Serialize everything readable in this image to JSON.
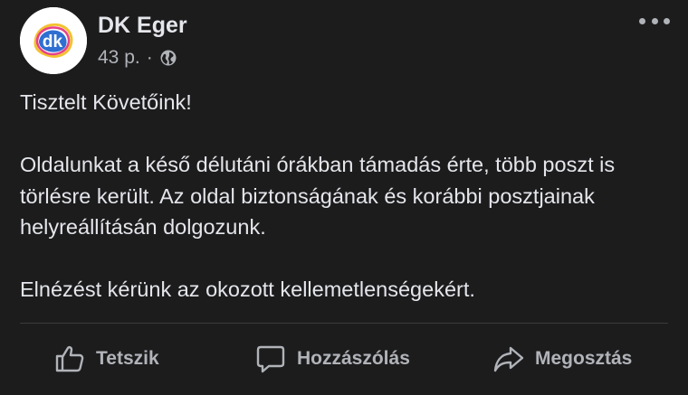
{
  "post": {
    "page_name": "DK Eger",
    "time": "43 p.",
    "separator": "·",
    "avatar_text": "dk",
    "privacy_icon": "globe-icon",
    "more_icon": "more-dots-icon",
    "paragraphs": [
      "Tisztelt Követőink!",
      "Oldalunkat a késő délutáni órákban támadás érte, több poszt is törlésre került. Az oldal biztonságának és korábbi posztjainak helyreállításán dolgozunk.",
      "Elnézést kérünk az okozott kellemetlenségekért."
    ]
  },
  "actions": {
    "like_label": "Tetszik",
    "comment_label": "Hozzászólás",
    "share_label": "Megosztás"
  },
  "colors": {
    "background": "#1c1c1d",
    "text_primary": "#e4e6eb",
    "text_secondary": "#b0b3b8",
    "avatar_blue": "#2f6fd1",
    "avatar_accent": "#f2c230"
  }
}
